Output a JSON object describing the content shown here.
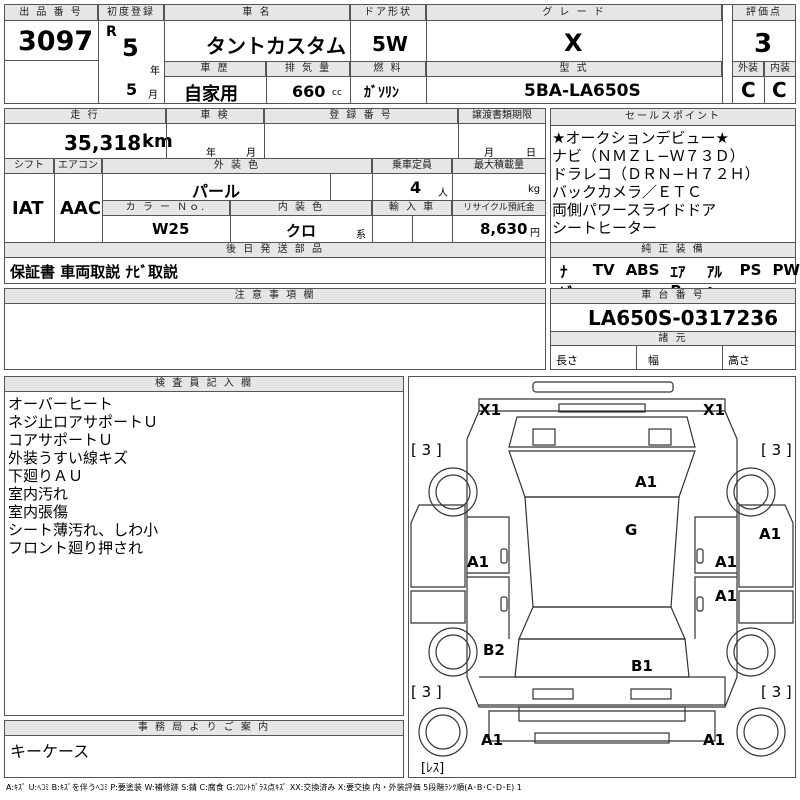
{
  "header": {
    "lot_label": "出 品 番 号",
    "lot_no": "3097",
    "reg_label": "初度登録",
    "era": "R",
    "reg_year": "5",
    "year_unit": "年",
    "reg_month": "5",
    "month_unit": "月",
    "name_label": "車 名",
    "name": "タントカスタム",
    "door_label": "ドア形状",
    "door": "5W",
    "grade_label": "グ レ ー ド",
    "grade": "X",
    "score_label": "評価点",
    "score": "3",
    "history_label": "車 歴",
    "history": "自家用",
    "displacement_label": "排 気 量",
    "displacement": "660",
    "displacement_unit": "cc",
    "fuel_label": "燃 料",
    "fuel": "ｶﾞｿﾘﾝ",
    "model_label": "型 式",
    "model": "5BA-LA650S",
    "exterior_label": "外装",
    "exterior": "C",
    "interior_label": "内装",
    "interior": "C"
  },
  "row2": {
    "mileage_label": "走 行",
    "mileage": "35,318",
    "mileage_unit": "km",
    "inspection_label": "車 検",
    "insp_year_unit": "年",
    "insp_month_unit": "月",
    "plate_label": "登 録 番 号",
    "transfer_label": "譲渡書類期限",
    "transfer_month_unit": "月",
    "transfer_day_unit": "日",
    "shift_label": "シフト",
    "shift": "IAT",
    "ac_label": "エアコン",
    "ac": "AAC",
    "color_label": "外 装 色",
    "color": "パール",
    "capacity_label": "乗車定員",
    "capacity": "4",
    "capacity_unit": "人",
    "load_label": "最大積載量",
    "load_unit": "kg",
    "colorno_label": "カ ラ ー Ｎｏ.",
    "colorno": "W25",
    "intcolor_label": "内 装 色",
    "intcolor": "クロ",
    "intcolor_unit": "系",
    "import_label": "輸 入 車",
    "recycle_label": "リサイクル預託金",
    "recycle": "8,630",
    "recycle_unit": "円",
    "later_label": "後 日 発 送 部 品",
    "later": "保証書 車両取説 ﾅﾋﾞ取説"
  },
  "sales": {
    "label": "セールスポイント",
    "lines": [
      "★オークションデビュー★",
      "ナビ（ＮＭＺＬ−Ｗ７３Ｄ）",
      "ドラレコ（ＤＲＮ−Ｈ７２Ｈ）",
      "バックカメラ／ＥＴＣ",
      "両側パワースライドドア",
      "シートヒーター"
    ]
  },
  "equipment": {
    "label": "純 正 装 備",
    "items": [
      "ﾅﾋﾞ",
      "TV",
      "ABS",
      "ｴｱB",
      "ｱﾙﾐ",
      "PS",
      "PW"
    ]
  },
  "notes": {
    "label": "注 意 事 項 欄"
  },
  "chassis": {
    "label": "車 台 番 号",
    "number": "LA650S-0317236",
    "dims_label": "諸 元",
    "length_label": "長さ",
    "width_label": "幅",
    "height_label": "高さ"
  },
  "inspector": {
    "label": "検 査 員 記 入 欄",
    "lines": [
      "オーバーヒート",
      "ネジ止ロアサポートＵ",
      "コアサポートＵ",
      "外装うすい線キズ",
      "下廻りＡＵ",
      "室内汚れ",
      "室内張傷",
      "シート薄汚れ、しわ小",
      "フロント廻り押され"
    ]
  },
  "office": {
    "label": "事 務 局 よ り ご 案 内",
    "text": "キーケース"
  },
  "diagram": {
    "codes": {
      "x1_left": "X1",
      "x1_right": "X1",
      "a1_hood": "A1",
      "g_roof": "G",
      "a1_fender_l": "A1",
      "a1_door_r": "A1",
      "a1_right_edge": "A1",
      "a1_rear_door_r": "A1",
      "b2_left": "B2",
      "b1_center": "B1",
      "a1_bumper_l": "A1",
      "a1_bumper_r": "A1"
    },
    "tires": {
      "fl": "[ 3 ]",
      "fr": "[ 3 ]",
      "rl": "[ 3 ]",
      "rr": "[ 3 ]"
    },
    "spare": "[ﾚｽ]"
  },
  "legend": "A:ｷｽﾞ U:ﾍｺﾐ B:ｷｽﾞを伴うﾍｺﾐ P:要塗装 W:補修跡 S:錆 C:腐食 G:ﾌﾛﾝﾄｶﾞﾗｽ点ｷｽﾞ XX:交換済み X:要交換 内・外装評価 5段階ﾗﾝｸ順(A･B･C･D･E) 1"
}
